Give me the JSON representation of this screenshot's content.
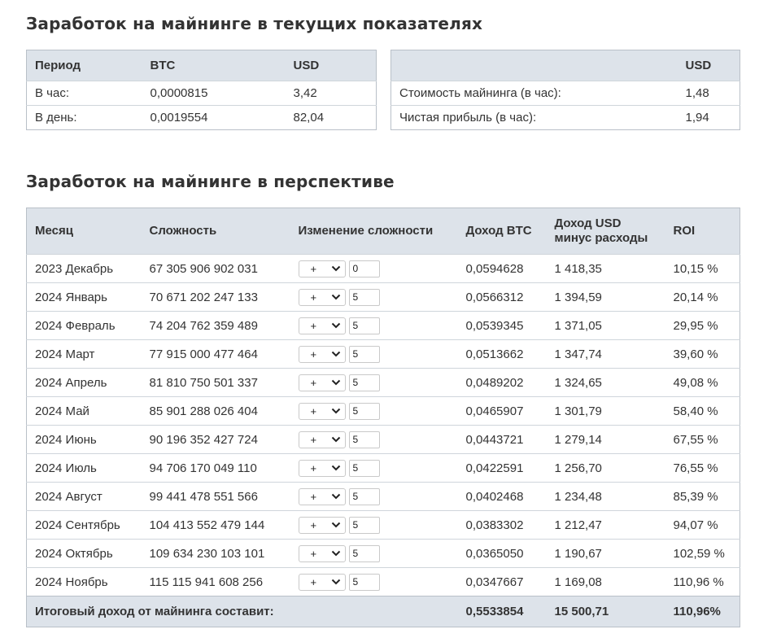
{
  "sections": {
    "current_title": "Заработок на майнинге в текущих показателях",
    "forecast_title": "Заработок на майнинге в перспективе"
  },
  "rates": {
    "headers": [
      "Период",
      "BTC",
      "USD"
    ],
    "rows": [
      [
        "В час:",
        "0,0000815",
        "3,42"
      ],
      [
        "В день:",
        "0,0019554",
        "82,04"
      ]
    ]
  },
  "cost": {
    "header_usd": "USD",
    "rows": [
      [
        "Стоимость майнинга (в час):",
        "1,48"
      ],
      [
        "Чистая прибыль (в час):",
        "1,94"
      ]
    ]
  },
  "forecast": {
    "headers": {
      "month": "Месяц",
      "difficulty": "Сложность",
      "change": "Изменение сложности",
      "income_btc": "Доход BTC",
      "income_usd_line1": "Доход USD",
      "income_usd_line2": "минус расходы",
      "roi": "ROI"
    },
    "rows": [
      {
        "month": "2023 Декабрь",
        "difficulty": "67 305 906 902 031",
        "sign": "+",
        "change": "0",
        "btc": "0,0594628",
        "usd": "1 418,35",
        "roi": "10,15 %"
      },
      {
        "month": "2024 Январь",
        "difficulty": "70 671 202 247 133",
        "sign": "+",
        "change": "5",
        "btc": "0,0566312",
        "usd": "1 394,59",
        "roi": "20,14 %"
      },
      {
        "month": "2024 Февраль",
        "difficulty": "74 204 762 359 489",
        "sign": "+",
        "change": "5",
        "btc": "0,0539345",
        "usd": "1 371,05",
        "roi": "29,95 %"
      },
      {
        "month": "2024 Март",
        "difficulty": "77 915 000 477 464",
        "sign": "+",
        "change": "5",
        "btc": "0,0513662",
        "usd": "1 347,74",
        "roi": "39,60 %"
      },
      {
        "month": "2024 Апрель",
        "difficulty": "81 810 750 501 337",
        "sign": "+",
        "change": "5",
        "btc": "0,0489202",
        "usd": "1 324,65",
        "roi": "49,08 %"
      },
      {
        "month": "2024 Май",
        "difficulty": "85 901 288 026 404",
        "sign": "+",
        "change": "5",
        "btc": "0,0465907",
        "usd": "1 301,79",
        "roi": "58,40 %"
      },
      {
        "month": "2024 Июнь",
        "difficulty": "90 196 352 427 724",
        "sign": "+",
        "change": "5",
        "btc": "0,0443721",
        "usd": "1 279,14",
        "roi": "67,55 %"
      },
      {
        "month": "2024 Июль",
        "difficulty": "94 706 170 049 110",
        "sign": "+",
        "change": "5",
        "btc": "0,0422591",
        "usd": "1 256,70",
        "roi": "76,55 %"
      },
      {
        "month": "2024 Август",
        "difficulty": "99 441 478 551 566",
        "sign": "+",
        "change": "5",
        "btc": "0,0402468",
        "usd": "1 234,48",
        "roi": "85,39 %"
      },
      {
        "month": "2024 Сентябрь",
        "difficulty": "104 413 552 479 144",
        "sign": "+",
        "change": "5",
        "btc": "0,0383302",
        "usd": "1 212,47",
        "roi": "94,07 %"
      },
      {
        "month": "2024 Октябрь",
        "difficulty": "109 634 230 103 101",
        "sign": "+",
        "change": "5",
        "btc": "0,0365050",
        "usd": "1 190,67",
        "roi": "102,59 %"
      },
      {
        "month": "2024 Ноябрь",
        "difficulty": "115 115 941 608 256",
        "sign": "+",
        "change": "5",
        "btc": "0,0347667",
        "usd": "1 169,08",
        "roi": "110,96 %"
      }
    ],
    "total": {
      "label": "Итоговый доход от майнинга составит:",
      "btc": "0,5533854",
      "usd": "15 500,71",
      "roi": "110,96%"
    }
  }
}
